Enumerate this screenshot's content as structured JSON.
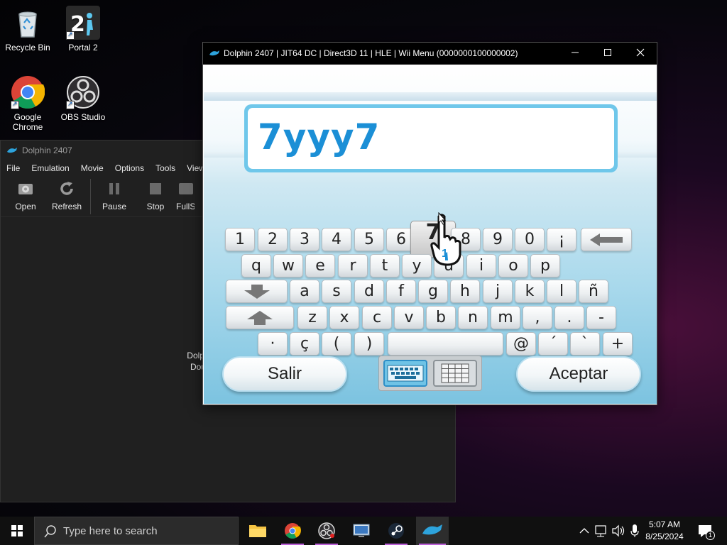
{
  "desktop": {
    "icons": [
      {
        "label": "Recycle Bin"
      },
      {
        "label": "Portal 2"
      },
      {
        "label": "Google Chrome"
      },
      {
        "label": "OBS Studio"
      }
    ]
  },
  "dolphin_main": {
    "title": "Dolphin 2407",
    "menu": [
      "File",
      "Emulation",
      "Movie",
      "Options",
      "Tools",
      "View"
    ],
    "toolbar": [
      "Open",
      "Refresh",
      "Pause",
      "Stop",
      "FullS"
    ],
    "message_line1": "Dolphin could not find",
    "message_line2": "Double-click he"
  },
  "emu_window": {
    "title": "Dolphin 2407 | JIT64 DC | Direct3D 11 | HLE | Wii Menu (0000000100000002)",
    "text_value": "7yyy7",
    "keyboard": {
      "row1": [
        "1",
        "2",
        "3",
        "4",
        "5",
        "6",
        "7",
        "8",
        "9",
        "0",
        "¡"
      ],
      "row2": [
        "q",
        "w",
        "e",
        "r",
        "t",
        "y",
        "u",
        "i",
        "o",
        "p"
      ],
      "row3": [
        "a",
        "s",
        "d",
        "f",
        "g",
        "h",
        "j",
        "k",
        "l",
        "ñ"
      ],
      "row4": [
        "z",
        "x",
        "c",
        "v",
        "b",
        "n",
        "m",
        ",",
        ".",
        "-"
      ],
      "row5": [
        "·",
        "ç",
        "(",
        ")",
        "@",
        "´",
        "`",
        "+"
      ]
    },
    "cancel_label": "Salir",
    "accept_label": "Aceptar",
    "cursor_badge": "1"
  },
  "taskbar": {
    "search_placeholder": "Type here to search",
    "time": "5:07 AM",
    "date": "8/25/2024",
    "notification_count": "1"
  },
  "colors": {
    "wii_blue": "#1b8fd6",
    "textbox_border": "#6fc7ea",
    "taskbar_bg": "#101010"
  }
}
